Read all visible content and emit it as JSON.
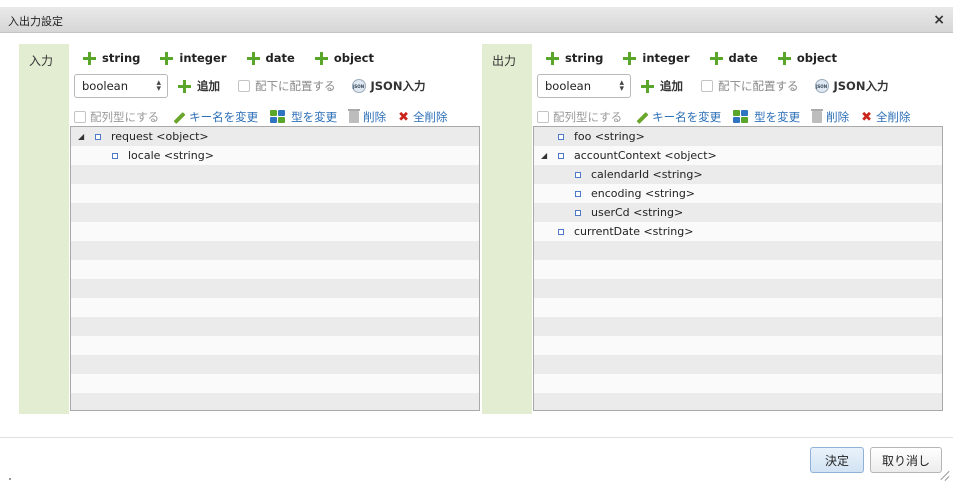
{
  "dialog": {
    "title": "入出力設定",
    "close_icon": "×"
  },
  "input_panel": {
    "label": "入力",
    "add_types": [
      "string",
      "integer",
      "date",
      "object"
    ],
    "type_select": "boolean",
    "add_label": "追加",
    "place_under_label": "配下に配置する",
    "json_input_label": "JSON入力",
    "array_label": "配列型にする",
    "rename_key_label": "キー名を変更",
    "change_type_label": "型を変更",
    "delete_label": "削除",
    "delete_all_label": "全削除",
    "tree": [
      {
        "text": "request <object>",
        "expanded": true,
        "level": 0
      },
      {
        "text": "locale <string>",
        "level": 1
      }
    ],
    "empty_rows": 13
  },
  "output_panel": {
    "label": "出力",
    "add_types": [
      "string",
      "integer",
      "date",
      "object"
    ],
    "type_select": "boolean",
    "add_label": "追加",
    "place_under_label": "配下に配置する",
    "json_input_label": "JSON入力",
    "array_label": "配列型にする",
    "rename_key_label": "キー名を変更",
    "change_type_label": "型を変更",
    "delete_label": "削除",
    "delete_all_label": "全削除",
    "tree": [
      {
        "text": "foo <string>",
        "level": 0
      },
      {
        "text": "accountContext <object>",
        "expanded": true,
        "level": 0
      },
      {
        "text": "calendarId <string>",
        "level": 1
      },
      {
        "text": "encoding <string>",
        "level": 1
      },
      {
        "text": "userCd <string>",
        "level": 1
      },
      {
        "text": "currentDate <string>",
        "level": 0
      }
    ],
    "empty_rows": 9
  },
  "footer": {
    "ok_label": "決定",
    "cancel_label": "取り消し"
  },
  "colors": {
    "label_bg": "#e3edd2",
    "plus_green": "#5aa62a",
    "link_blue": "#2b6fb7",
    "delete_red": "#c9271e"
  }
}
